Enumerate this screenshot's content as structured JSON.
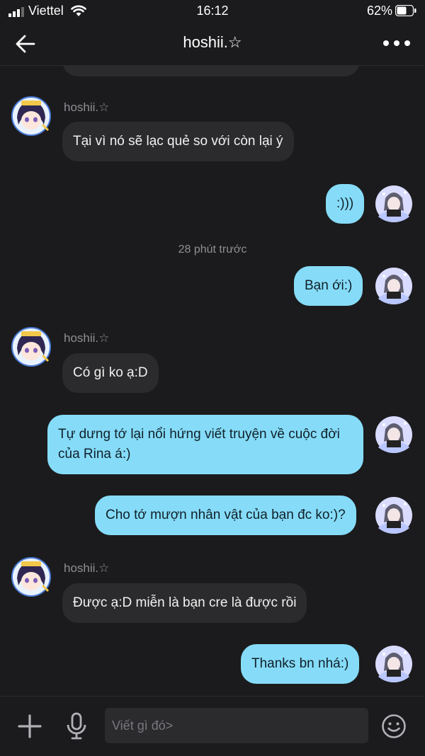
{
  "status_bar": {
    "carrier": "Viettel",
    "time": "16:12",
    "battery": "62%"
  },
  "header": {
    "title": "hoshii.☆"
  },
  "messages": [
    {
      "sender": "hoshii.☆",
      "text": "Tại vì nó sẽ lạc quẻ so với còn lại ý"
    },
    {
      "text": ":)))"
    },
    {
      "timestamp": "28 phút trước"
    },
    {
      "text": "Bạn ới:)"
    },
    {
      "sender": "hoshii.☆",
      "text": "Có gì ko ạ:D"
    },
    {
      "text": "Tự dưng tớ lại nổi hứng viết truyện về cuộc đời của Rina á:)"
    },
    {
      "text": "Cho tớ mượn nhân vật của bạn đc ko:)?"
    },
    {
      "sender": "hoshii.☆",
      "text": "Được ạ:D miễn là bạn cre là được rồi"
    },
    {
      "text": "Thanks bn nhá:)"
    }
  ],
  "input": {
    "placeholder": "Viết gì đó>"
  },
  "colors": {
    "background": "#1b1b1d",
    "incoming_bubble": "#2b2b2d",
    "outgoing_bubble": "#86dcf8"
  }
}
